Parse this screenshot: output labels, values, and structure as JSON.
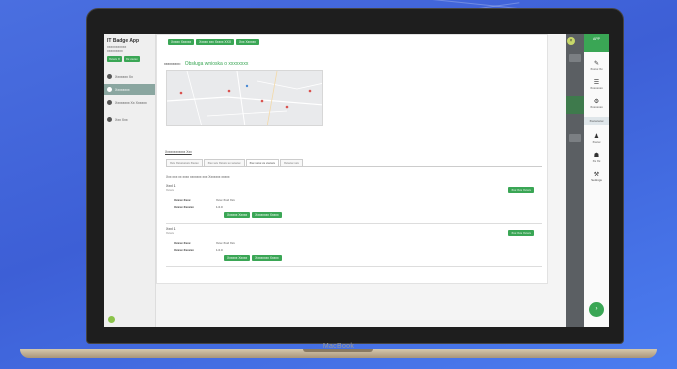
{
  "device": {
    "label": "MacBook"
  },
  "sidebar": {
    "app_title": "IT Badge App",
    "app_sub_1": "xxxxxxxxxxx",
    "app_sub_2": "xxxxxxxxx",
    "btn_1": "Xxxxx X",
    "btn_2": "Xx xxxxx",
    "items": [
      {
        "label": "Xxxxxxx Xx"
      },
      {
        "label": "Xxxxxxxx"
      },
      {
        "label": "Xxxxxxxx Xx Xxxxxx"
      },
      {
        "label": "Xxx Xxx"
      }
    ]
  },
  "toolbar": {
    "btn_1": "Xxxxx Xxxxxx",
    "btn_2": "Xxxxx xxx Xxxxx XXX",
    "btn_3": "Xxx Xxxxxx"
  },
  "location": {
    "label": "xxxxxxxxx:",
    "value": "Obsługa wnioska o xxxxxxxx"
  },
  "section_link": "Xxxxxxxxxxxx Xxx",
  "tabs": [
    {
      "label": "Xxx Xxxxxxxxx Xxxxx"
    },
    {
      "label": "Xxx xxx Xxxxx xx xxxxxx"
    },
    {
      "label": "Xxx xxxx xx xxxxxx"
    },
    {
      "label": "Xxxxxx xxx"
    }
  ],
  "description": "Xxx xxx xx xxxx xxxxxxx xxx Xxxxxxx xxxxx",
  "plugins": [
    {
      "name": "Xxxl 1",
      "sub": "Xxxxx",
      "add_label": "Xxx Xxx Xxxxx",
      "key_1": "Xxxxx Xxxx",
      "val_1": "Xxxx Xxxl Xxx",
      "key_2": "Xxxxx Xxxxxx",
      "val_2": "1.0.0",
      "action_1": "Xxxxxx Xxxxx",
      "action_2": "Xxxxxxxx Xxxxx"
    },
    {
      "name": "Xxxl 1",
      "sub": "Xxxxx",
      "add_label": "Xxx Xxx Xxxxx",
      "key_1": "Xxxxx Xxxx",
      "val_1": "Xxxx Xxxl Xxx",
      "key_2": "Xxxxx Xxxxxx",
      "val_2": "1.0.0",
      "action_1": "Xxxxxx Xxxxx",
      "action_2": "Xxxxxxxx Xxxxx"
    }
  ],
  "right_menu": {
    "logo": "APP",
    "items": [
      {
        "icon": "✎",
        "label": "Xxxxx Xx"
      },
      {
        "icon": "☰",
        "label": "Xxxxxxxx"
      },
      {
        "icon": "⚙",
        "label": "Xxxxxxxx"
      },
      {
        "icon": "",
        "label": "Xxxxxxxxx"
      },
      {
        "icon": "♟",
        "label": "Xxxxx"
      },
      {
        "icon": "☗",
        "label": "Xx Xx"
      },
      {
        "icon": "⚒",
        "label": "Settings"
      }
    ]
  },
  "colors": {
    "accent": "#3aa655",
    "background": "#4a6fe0"
  }
}
